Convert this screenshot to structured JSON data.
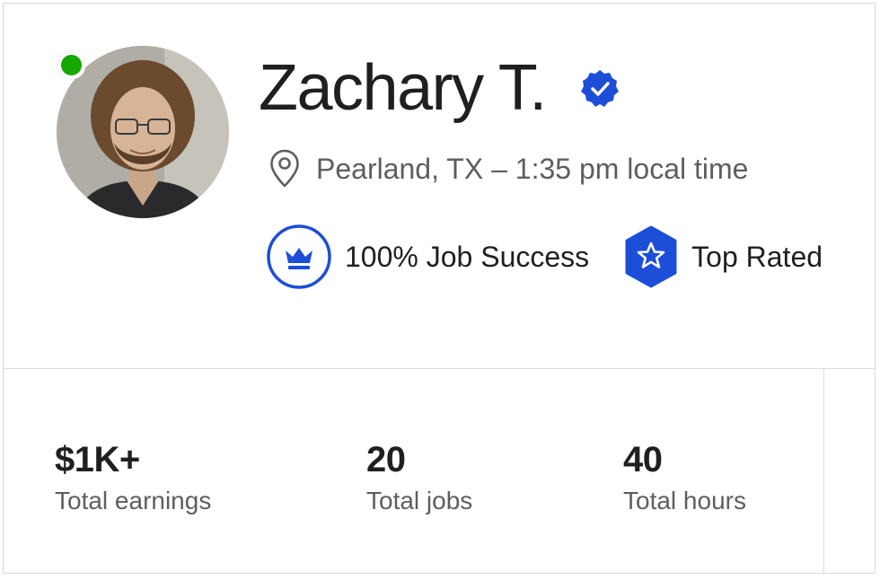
{
  "profile": {
    "name": "Zachary T.",
    "location": "Pearland, TX – 1:35 pm local time",
    "online": true,
    "verified": true
  },
  "badges": [
    {
      "label": "100% Job Success",
      "icon": "crown-icon"
    },
    {
      "label": "Top Rated",
      "icon": "star-badge-icon"
    }
  ],
  "stats": [
    {
      "value": "$1K+",
      "label": "Total earnings"
    },
    {
      "value": "20",
      "label": "Total jobs"
    },
    {
      "value": "40",
      "label": "Total hours"
    }
  ],
  "colors": {
    "online": "#14a800",
    "accent_blue": "#1d4ed8",
    "text_primary": "#1f1f1f",
    "text_secondary": "#5e5e5e"
  }
}
